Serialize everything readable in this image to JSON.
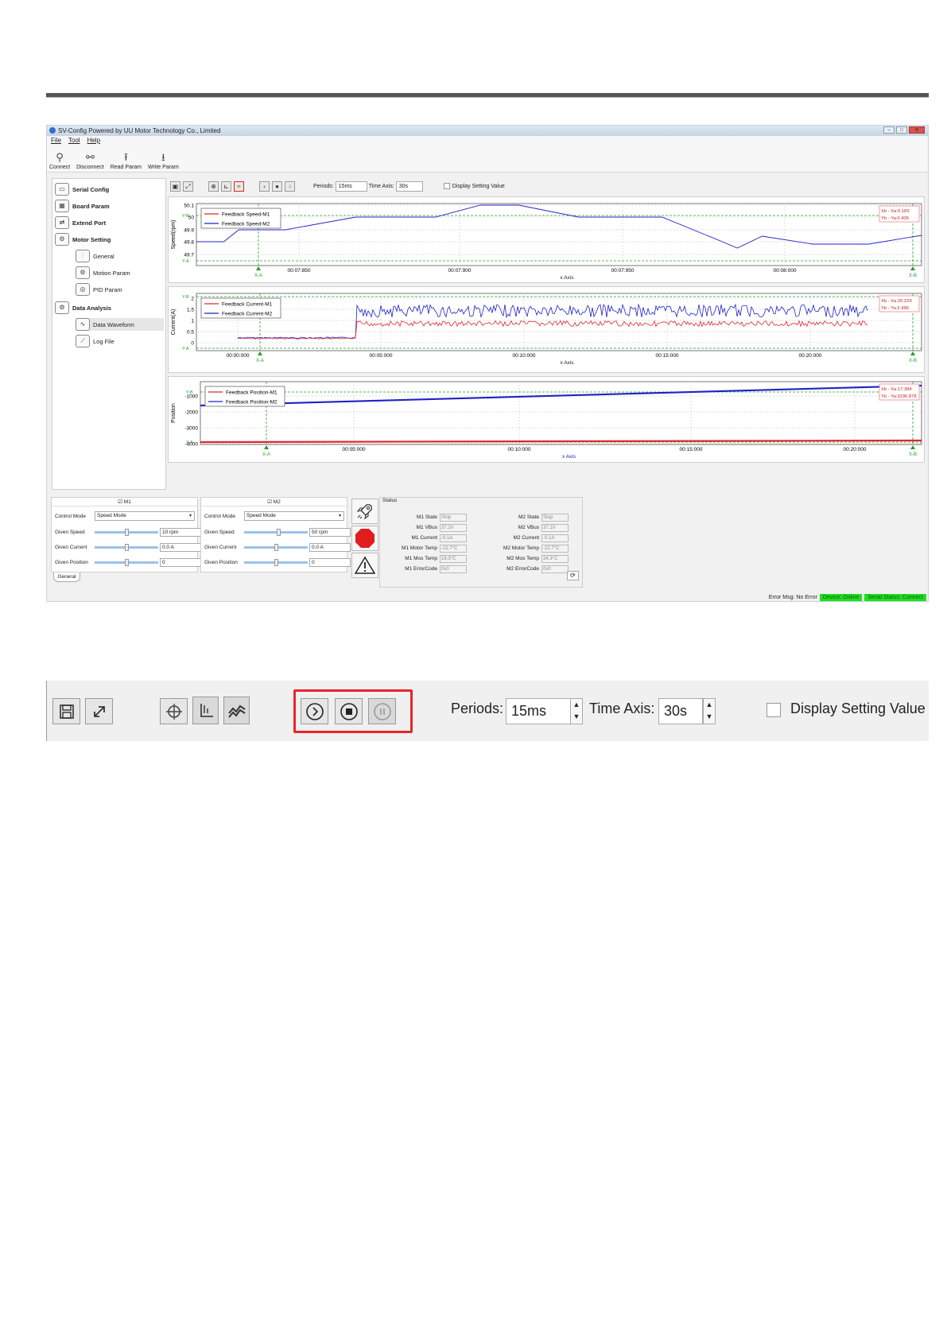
{
  "window": {
    "title": "SV-Config Powered by UU Motor Technology Co., Limited",
    "menu": [
      "File",
      "Tool",
      "Help"
    ],
    "toolbar": [
      {
        "label": "Connect",
        "icon": "connect-icon"
      },
      {
        "label": "Disconnect",
        "icon": "disconnect-icon"
      },
      {
        "label": "Read Param",
        "icon": "upload-icon"
      },
      {
        "label": "Write Param",
        "icon": "download-icon"
      }
    ]
  },
  "sidebar": {
    "items": [
      {
        "label": "Serial Config",
        "icon": "serial-port-icon",
        "level": 0
      },
      {
        "label": "Board Param",
        "icon": "chip-icon",
        "level": 0
      },
      {
        "label": "Extend Port",
        "icon": "extend-port-icon",
        "level": 0
      },
      {
        "label": "Motor Setting",
        "icon": "motor-gear-icon",
        "level": 0
      },
      {
        "label": "General",
        "icon": "sliders-icon",
        "level": 1
      },
      {
        "label": "Motion Param",
        "icon": "gears-icon",
        "level": 1
      },
      {
        "label": "PID Param",
        "icon": "pid-icon",
        "level": 1
      },
      {
        "label": "Data Analysis",
        "icon": "settings-gear-icon",
        "level": 0
      },
      {
        "label": "Data Waveform",
        "icon": "waveform-icon",
        "level": 1,
        "selected": true
      },
      {
        "label": "Log File",
        "icon": "log-chart-icon",
        "level": 1
      }
    ]
  },
  "waveform_toolbar": {
    "periods_label": "Periods:",
    "periods_value": "15ms",
    "time_axis_label": "Time Axis:",
    "time_axis_value": "30s",
    "display_setting_label": "Display Setting Value",
    "display_setting_checked": false
  },
  "charts": {
    "speed": {
      "ylabel": "Speed(rpm)",
      "xlabel": "x Axis",
      "legend": [
        "Feedback Speed-M1",
        "Feedback Speed-M2"
      ],
      "yticks": [
        "50.1",
        "50",
        "49.9",
        "49.8",
        "49.7"
      ],
      "xticks": [
        "00:07:850",
        "00:07:900",
        "00:07:950",
        "00:08:000"
      ],
      "cursor_x": [
        "X-A",
        "X-B"
      ],
      "cursor_y": [
        "Y-B",
        "Y-A"
      ],
      "readout": [
        "Xb - Xa:0.183",
        "Yb - Ya:0.405"
      ]
    },
    "current": {
      "ylabel": "Current(A)",
      "xlabel": "x Axis",
      "legend": [
        "Feedback Current-M1",
        "Feedback Current-M2"
      ],
      "yticks": [
        "2",
        "1.5",
        "1",
        "0.5",
        "0"
      ],
      "xticks": [
        "00:00:000",
        "00:05:000",
        "00:10:000",
        "00:15:000",
        "00:20:000"
      ],
      "cursor_x": [
        "X-A",
        "X-B"
      ],
      "cursor_y": [
        "Y-B",
        "Y-A"
      ],
      "readout": [
        "Xb - Xa:20.229",
        "Yb - Ya:2.496"
      ]
    },
    "position": {
      "ylabel": "Position",
      "xlabel": "x Axis",
      "legend": [
        "Feedback Position-M1",
        "Feedback Position-M2"
      ],
      "yticks": [
        "-1000",
        "-2000",
        "-3000",
        "-4000"
      ],
      "xticks": [
        "00:05:000",
        "00:10:000",
        "00:15:000",
        "00:20:000"
      ],
      "cursor_x": [
        "X-A",
        "X-B"
      ],
      "cursor_y": [
        "Y-B",
        "Y-A"
      ],
      "readout": [
        "Xb - Xa:17.384",
        "Yb - Ya:3236.878"
      ]
    }
  },
  "motor_panels": [
    {
      "name": "M1",
      "checked": true,
      "control_mode_label": "Control Mode",
      "control_mode": "Speed Mode",
      "given_speed_label": "Given Speed",
      "given_speed": "10 rpm",
      "speed_level": 0.5,
      "given_current_label": "Given Current",
      "given_current": "0.0 A",
      "current_level": 0.5,
      "given_position_label": "Given Position",
      "given_position": "0",
      "position_level": 0.5
    },
    {
      "name": "M2",
      "checked": true,
      "control_mode_label": "Control Mode",
      "control_mode": "Speed Mode",
      "given_speed_label": "Given Speed",
      "given_speed": "50 rpm",
      "speed_level": 0.55,
      "given_current_label": "Given Current",
      "given_current": "0.0 A",
      "current_level": 0.5,
      "given_position_label": "Given Position",
      "given_position": "0",
      "position_level": 0.5
    }
  ],
  "control_tab": "General",
  "action_buttons": [
    "rocket-icon",
    "stop-sign-icon",
    "warning-icon"
  ],
  "status": {
    "title": "Status",
    "m1": [
      {
        "k": "M1 State",
        "v": "Stop"
      },
      {
        "k": "M1 VBus",
        "v": "37.2V"
      },
      {
        "k": "M1 Current",
        "v": "-0.1A"
      },
      {
        "k": "M1 Motor Temp",
        "v": "-22.7°C"
      },
      {
        "k": "M1 Mos Temp",
        "v": "18.3°C"
      },
      {
        "k": "M1 ErrorCode",
        "v": "0x0"
      }
    ],
    "m2": [
      {
        "k": "M2 State",
        "v": "Stop"
      },
      {
        "k": "M2 VBus",
        "v": "37.1V"
      },
      {
        "k": "M2 Current",
        "v": "-0.1A"
      },
      {
        "k": "M2 Motor Temp",
        "v": "-22.7°C"
      },
      {
        "k": "M2 Mos Temp",
        "v": "24.3°C"
      },
      {
        "k": "M2 ErrorCode",
        "v": "0x0"
      }
    ]
  },
  "statusbar": {
    "error_msg": "Error Msg: No Error",
    "device": "Device: Online",
    "serial": "Serial Status: Connect"
  },
  "zoom_toolbar": {
    "periods_label": "Periods:",
    "periods_value": "15ms",
    "time_axis_label": "Time Axis:",
    "time_axis_value": "30s",
    "display_setting_label": "Display Setting Value"
  },
  "colors": {
    "series_m1": "#e0262c",
    "series_m2": "#1f22c8",
    "cursor": "#2a9a2a",
    "highlight": "#e8262b",
    "status_ok": "#1fe01f"
  }
}
